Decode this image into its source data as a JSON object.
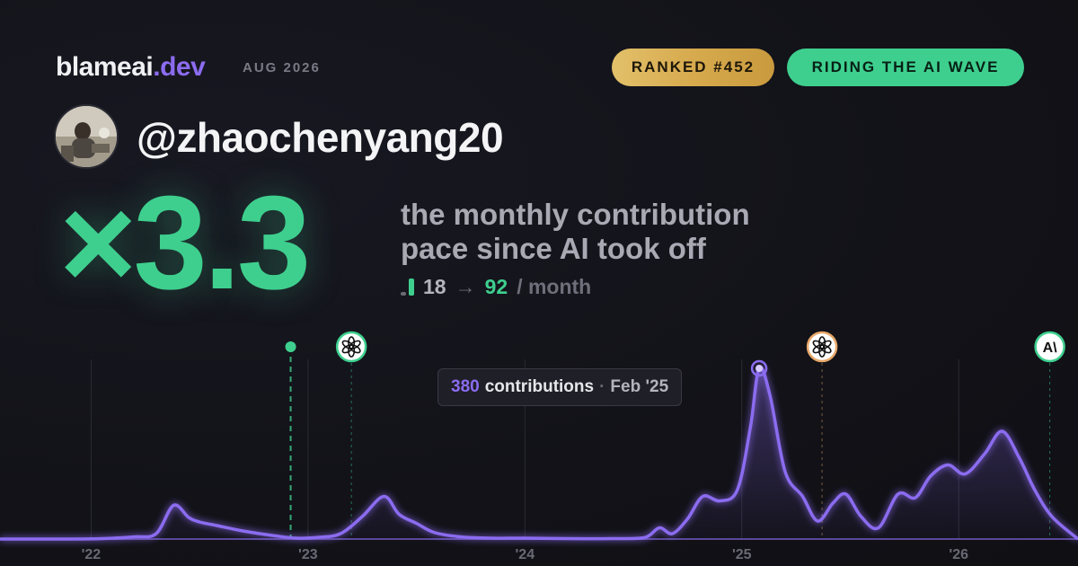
{
  "brand": {
    "name": "blameai",
    "tld": ".dev",
    "date": "AUG 2026"
  },
  "badges": {
    "rank": "RANKED #452",
    "wave": "RIDING THE AI WAVE"
  },
  "user": {
    "handle": "@zhaochenyang20"
  },
  "headline": {
    "multiplier": "×3.3",
    "line1": "the monthly contribution",
    "line2": "pace since AI took off",
    "from": "18",
    "arrow": "→",
    "to": "92",
    "unit": "/ month"
  },
  "colors": {
    "accent": "#3ecf8e",
    "line": "#8b6cf0",
    "gold": "#d7aa4e",
    "openai_marker": "#3ecf8e",
    "openai_orange_marker": "#e8a86a",
    "anthropic_marker": "#3ecf8e"
  },
  "tooltip": {
    "value": "380",
    "label": "contributions",
    "date": "Feb '25"
  },
  "chart_data": {
    "type": "area",
    "xlabel": "",
    "ylabel": "",
    "x_ticks": [
      "'22",
      "'23",
      "'24",
      "'25",
      "'26"
    ],
    "x_tick_values": [
      2022.0,
      2023.0,
      2024.0,
      2025.0,
      2026.0
    ],
    "xlim": [
      2021.58,
      2026.55
    ],
    "ylim": [
      0,
      420
    ],
    "grid": "vertical",
    "x": [
      2021.58,
      2021.75,
      2021.9,
      2022.05,
      2022.2,
      2022.3,
      2022.38,
      2022.45,
      2022.5,
      2022.58,
      2022.7,
      2022.85,
      2022.95,
      2023.05,
      2023.15,
      2023.25,
      2023.35,
      2023.42,
      2023.5,
      2023.58,
      2023.7,
      2023.85,
      2024.0,
      2024.2,
      2024.4,
      2024.55,
      2024.62,
      2024.68,
      2024.75,
      2024.82,
      2024.9,
      2024.98,
      2025.04,
      2025.08,
      2025.13,
      2025.2,
      2025.28,
      2025.35,
      2025.42,
      2025.48,
      2025.55,
      2025.63,
      2025.72,
      2025.8,
      2025.87,
      2025.95,
      2026.03,
      2026.12,
      2026.2,
      2026.28,
      2026.35,
      2026.43,
      2026.55
    ],
    "series": [
      {
        "values": [
          0,
          0,
          0,
          1,
          5,
          12,
          75,
          48,
          38,
          30,
          18,
          7,
          2,
          4,
          12,
          50,
          95,
          55,
          35,
          15,
          5,
          2,
          2,
          1,
          1,
          3,
          25,
          12,
          45,
          95,
          85,
          110,
          250,
          380,
          320,
          150,
          95,
          40,
          80,
          100,
          50,
          25,
          100,
          92,
          140,
          165,
          145,
          190,
          240,
          180,
          110,
          50,
          0
        ]
      }
    ],
    "events": [
      {
        "x": 2022.92,
        "kind": "dot"
      },
      {
        "x": 2023.2,
        "kind": "openai-logo"
      },
      {
        "x": 2025.37,
        "kind": "openai-logo-orange"
      },
      {
        "x": 2026.42,
        "kind": "anthropic-logo"
      }
    ],
    "highlight": {
      "x": 2025.08,
      "y": 380
    }
  }
}
